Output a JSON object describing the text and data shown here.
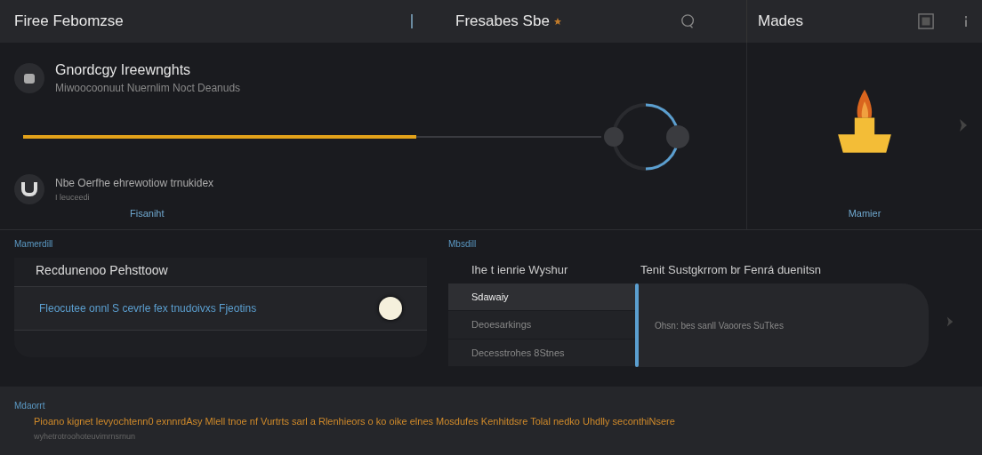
{
  "header": {
    "title": "Firee Febomzse",
    "center_title": "Fresabes Sbe",
    "right_title": "Mades"
  },
  "progress_section": {
    "items": [
      {
        "title": "Gnordcgy Ireewnghts",
        "subtitle": "Miwoocoonuut Nuernlim Noct Deanuds"
      },
      {
        "title": "Nbe Oerfhe ehrewotiow trnukidex",
        "subtitle": "I leuceedi"
      }
    ],
    "level": 0.68,
    "left_caption": "Fisaniht",
    "right_caption": "Mamier"
  },
  "settings": {
    "label": "Mamerdill",
    "heading": "Recdunenoo Pehsttoow",
    "row": {
      "text": "Fleocutee onnl S cevrle fex tnudoivxs Fjeotins",
      "on": true
    }
  },
  "list_panel": {
    "label": "Mbsdill",
    "column_heading": "Ihe t ienrie Wyshur",
    "detail_heading": "Tenit Sustgkrrom br Fenrá duenitsn",
    "items": [
      {
        "label": "Sdawaiy",
        "selected": true
      },
      {
        "label": "Deoesarkings",
        "selected": false
      },
      {
        "label": "Decesstrohes 8Stnes",
        "selected": false
      }
    ],
    "detail_text": "Ohsn: bes sanll Vaoores SuTkes"
  },
  "footer": {
    "label": "Mdaorrt",
    "text": "Pioano kignet levyochtenn0 exnnrdAsy Mlell tnoe nf Vurtrts  sarl a Rlenhieors  o  ko oike elnes  Mosdufes Kenhitdsre Tolal nedko Uhdlly seconthiNsere",
    "subtext": "wyhetrotroohoteuvimrnsrnun"
  }
}
